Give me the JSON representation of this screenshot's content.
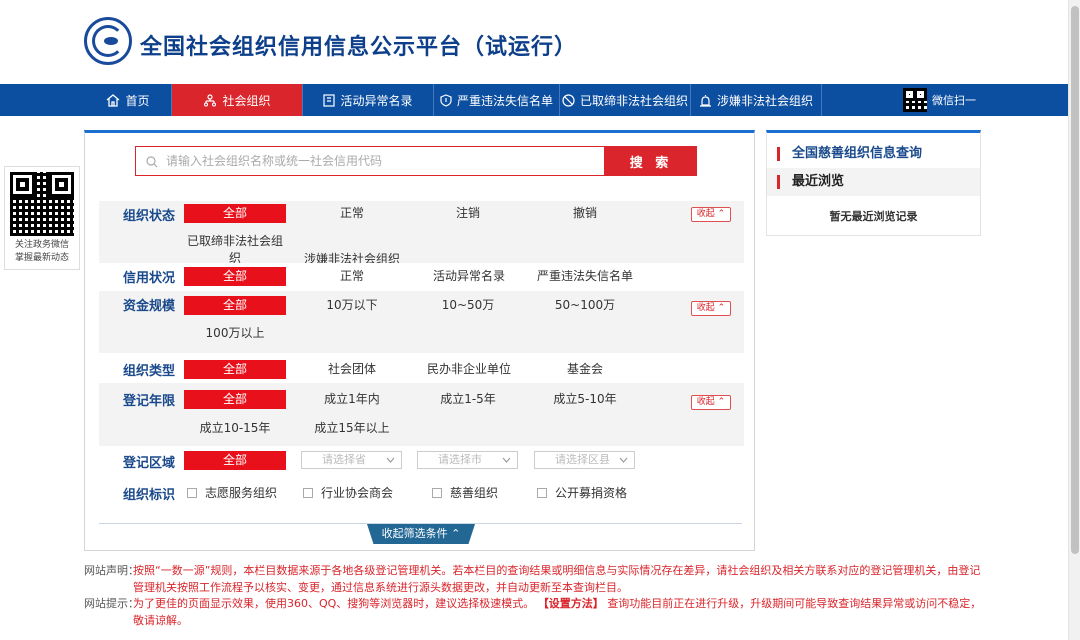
{
  "header": {
    "title": "全国社会组织信用信息公示平台（试运行）"
  },
  "nav": {
    "items": [
      {
        "label": "首页",
        "icon": "home-icon"
      },
      {
        "label": "社会组织",
        "icon": "org-tree-icon",
        "active": true
      },
      {
        "label": "活动异常名录",
        "icon": "list-icon"
      },
      {
        "label": "严重违法失信名单",
        "icon": "shield-icon"
      },
      {
        "label": "已取缔非法社会组织",
        "icon": "ban-icon"
      },
      {
        "label": "涉嫌非法社会组织",
        "icon": "alarm-icon"
      }
    ],
    "wechat_label": "微信扫一"
  },
  "side_qr": {
    "line1": "关注政务微信",
    "line2": "掌握最新动态"
  },
  "search": {
    "placeholder": "请输入社会组织名称或统一社会信用代码",
    "button_label": "搜 索"
  },
  "filters": {
    "status": {
      "label": "组织状态",
      "options": [
        "全部",
        "正常",
        "注销",
        "撤销",
        "已取缔非法社会组织",
        "涉嫌非法社会组织"
      ]
    },
    "credit": {
      "label": "信用状况",
      "options": [
        "全部",
        "正常",
        "活动异常名录",
        "严重违法失信名单"
      ]
    },
    "capital": {
      "label": "资金规模",
      "options": [
        "全部",
        "10万以下",
        "10~50万",
        "50~100万",
        "100万以上"
      ]
    },
    "type": {
      "label": "组织类型",
      "options": [
        "全部",
        "社会团体",
        "民办非企业单位",
        "基金会"
      ]
    },
    "years": {
      "label": "登记年限",
      "options": [
        "全部",
        "成立1年内",
        "成立1-5年",
        "成立5-10年",
        "成立10-15年",
        "成立15年以上"
      ]
    },
    "region": {
      "label": "登记区域",
      "all": "全部",
      "province_placeholder": "请选择省",
      "city_placeholder": "请选择市",
      "district_placeholder": "请选择区县"
    },
    "tags": {
      "label": "组织标识",
      "options": [
        "志愿服务组织",
        "行业协会商会",
        "慈善组织",
        "公开募捐资格"
      ]
    },
    "collapse_label": "收起",
    "toggle_label": "收起筛选条件"
  },
  "sidebar": {
    "charity_query": "全国慈善组织信息查询",
    "recent_title": "最近浏览",
    "recent_empty": "暂无最近浏览记录"
  },
  "notice": {
    "statement_key": "网站声明：",
    "statement": "按照“一数一源”规则，本栏目数据来源于各地各级登记管理机关。若本栏目的查询结果或明细信息与实际情况存在差异，请社会组织及相关方联系对应的登记管理机关，由登记管理机关按照工作流程予以核实、变更，通过信息系统进行源头数据更改，并自动更新至本查询栏目。",
    "tip_key": "网站提示：",
    "tip_a": "为了更佳的页面显示效果，使用360、QQ、搜狗等浏览器时，建议选择极速模式。",
    "tip_link": "【设置方法】",
    "tip_b": "查询功能目前正在进行升级，升级期间可能导致查询结果异常或访问不稳定，敬请谅解。"
  },
  "colors": {
    "brand_blue": "#0c4fa0",
    "accent_red": "#d9252b"
  }
}
